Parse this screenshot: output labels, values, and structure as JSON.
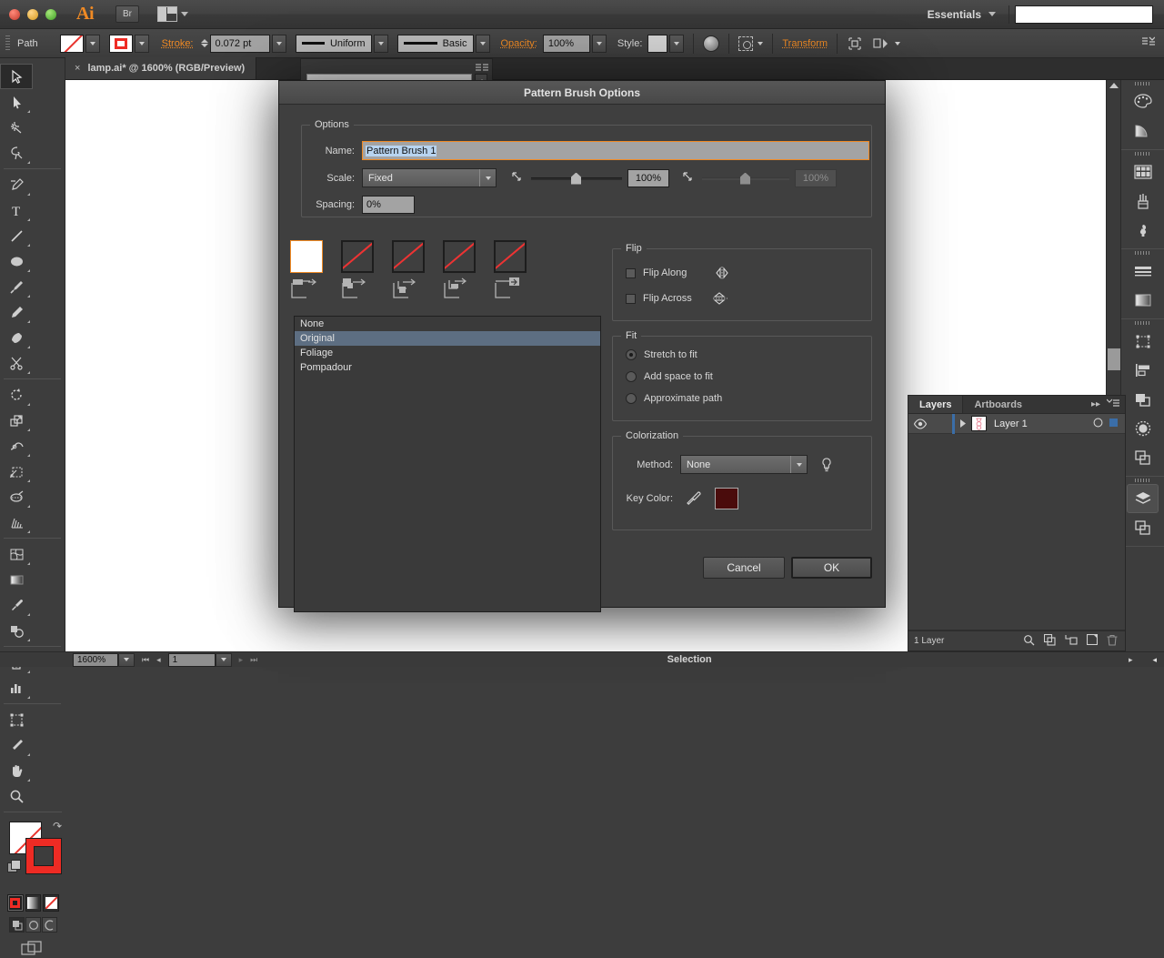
{
  "menubar": {
    "app_logo": "Ai",
    "bridge_button": "Br",
    "arrange_label": "arrange-documents",
    "workspace": "Essentials",
    "search_value": ""
  },
  "controlbar": {
    "object_label": "Path",
    "stroke_label": "Stroke:",
    "stroke_weight": "0.072 pt",
    "stroke_profile": "Uniform",
    "brush_definition": "Basic",
    "opacity_label": "Opacity:",
    "opacity_value": "100%",
    "style_label": "Style:",
    "transform_label": "Transform"
  },
  "document_tab": {
    "close": "×",
    "title": "lamp.ai* @ 1600% (RGB/Preview)"
  },
  "dialog": {
    "title": "Pattern Brush Options",
    "options_group": "Options",
    "name_label": "Name:",
    "name_value": "Pattern Brush 1",
    "scale_label": "Scale:",
    "scale_mode": "Fixed",
    "scale_value_1": "100%",
    "scale_value_2": "100%",
    "spacing_label": "Spacing:",
    "spacing_value": "0%",
    "tiles": [
      {
        "name": "side-tile",
        "selected": true
      },
      {
        "name": "outer-corner-tile",
        "selected": false
      },
      {
        "name": "inner-corner-tile",
        "selected": false
      },
      {
        "name": "start-tile",
        "selected": false
      },
      {
        "name": "end-tile",
        "selected": false
      }
    ],
    "tile_list": [
      {
        "label": "None",
        "selected": false
      },
      {
        "label": "Original",
        "selected": true
      },
      {
        "label": "Foliage",
        "selected": false
      },
      {
        "label": "Pompadour",
        "selected": false
      }
    ],
    "flip_group": "Flip",
    "flip_along": "Flip Along",
    "flip_across": "Flip Across",
    "flip_along_checked": false,
    "flip_across_checked": false,
    "fit_group": "Fit",
    "fit_options": [
      {
        "label": "Stretch to fit",
        "selected": true
      },
      {
        "label": "Add space to fit",
        "selected": false
      },
      {
        "label": "Approximate path",
        "selected": false
      }
    ],
    "colorization_group": "Colorization",
    "method_label": "Method:",
    "method_value": "None",
    "key_color_label": "Key Color:",
    "key_color_hex": "#4a0c0c",
    "cancel_label": "Cancel",
    "ok_label": "OK"
  },
  "layers_panel": {
    "tabs": [
      {
        "label": "Layers",
        "active": true
      },
      {
        "label": "Artboards",
        "active": false
      }
    ],
    "rows": [
      {
        "name": "Layer 1",
        "visible": true,
        "locked": false
      }
    ],
    "footer_count": "1 Layer"
  },
  "statusbar": {
    "zoom": "1600%",
    "page": "1",
    "status": "Selection"
  },
  "toolbar": {
    "tools": [
      "selection-tool",
      "direct-selection-tool",
      "magic-wand-tool",
      "lasso-tool",
      "pen-tool",
      "type-tool",
      "line-segment-tool",
      "ellipse-tool",
      "paintbrush-tool",
      "pencil-tool",
      "blob-brush-tool",
      "scissors-tool",
      "rotate-tool",
      "scale-tool",
      "width-tool",
      "free-transform-tool",
      "shape-builder-tool",
      "perspective-grid-tool",
      "mesh-tool",
      "gradient-tool",
      "eyedropper-tool",
      "blend-tool",
      "symbol-sprayer-tool",
      "column-graph-tool",
      "artboard-tool",
      "slice-tool",
      "hand-tool",
      "zoom-tool"
    ],
    "fill_stroke": "fill-stroke-indicator",
    "color_modes": [
      "color-mode",
      "gradient-mode",
      "none-mode"
    ],
    "draw_modes": [
      "draw-normal",
      "draw-behind",
      "draw-inside"
    ],
    "screen_mode": "change-screen-mode"
  },
  "dock": {
    "groups": [
      [
        "color-panel-icon",
        "color-guide-panel-icon"
      ],
      [
        "swatches-panel-icon",
        "brushes-panel-icon",
        "symbols-panel-icon"
      ],
      [
        "stroke-panel-icon",
        "gradient-panel-icon"
      ],
      [
        "transform-panel-icon",
        "align-panel-icon",
        "pathfinder-panel-icon",
        "transparency-panel-icon",
        "appearance-panel-icon"
      ],
      [
        "layers-panel-icon",
        "artboards-panel-icon"
      ]
    ]
  },
  "colors": {
    "accent": "#f08a24",
    "selection_blue": "#5d6e82",
    "panel_bg": "#3d3d3d",
    "dialog_bg": "#3f3f3f",
    "stroke_red": "#ee2b24"
  }
}
